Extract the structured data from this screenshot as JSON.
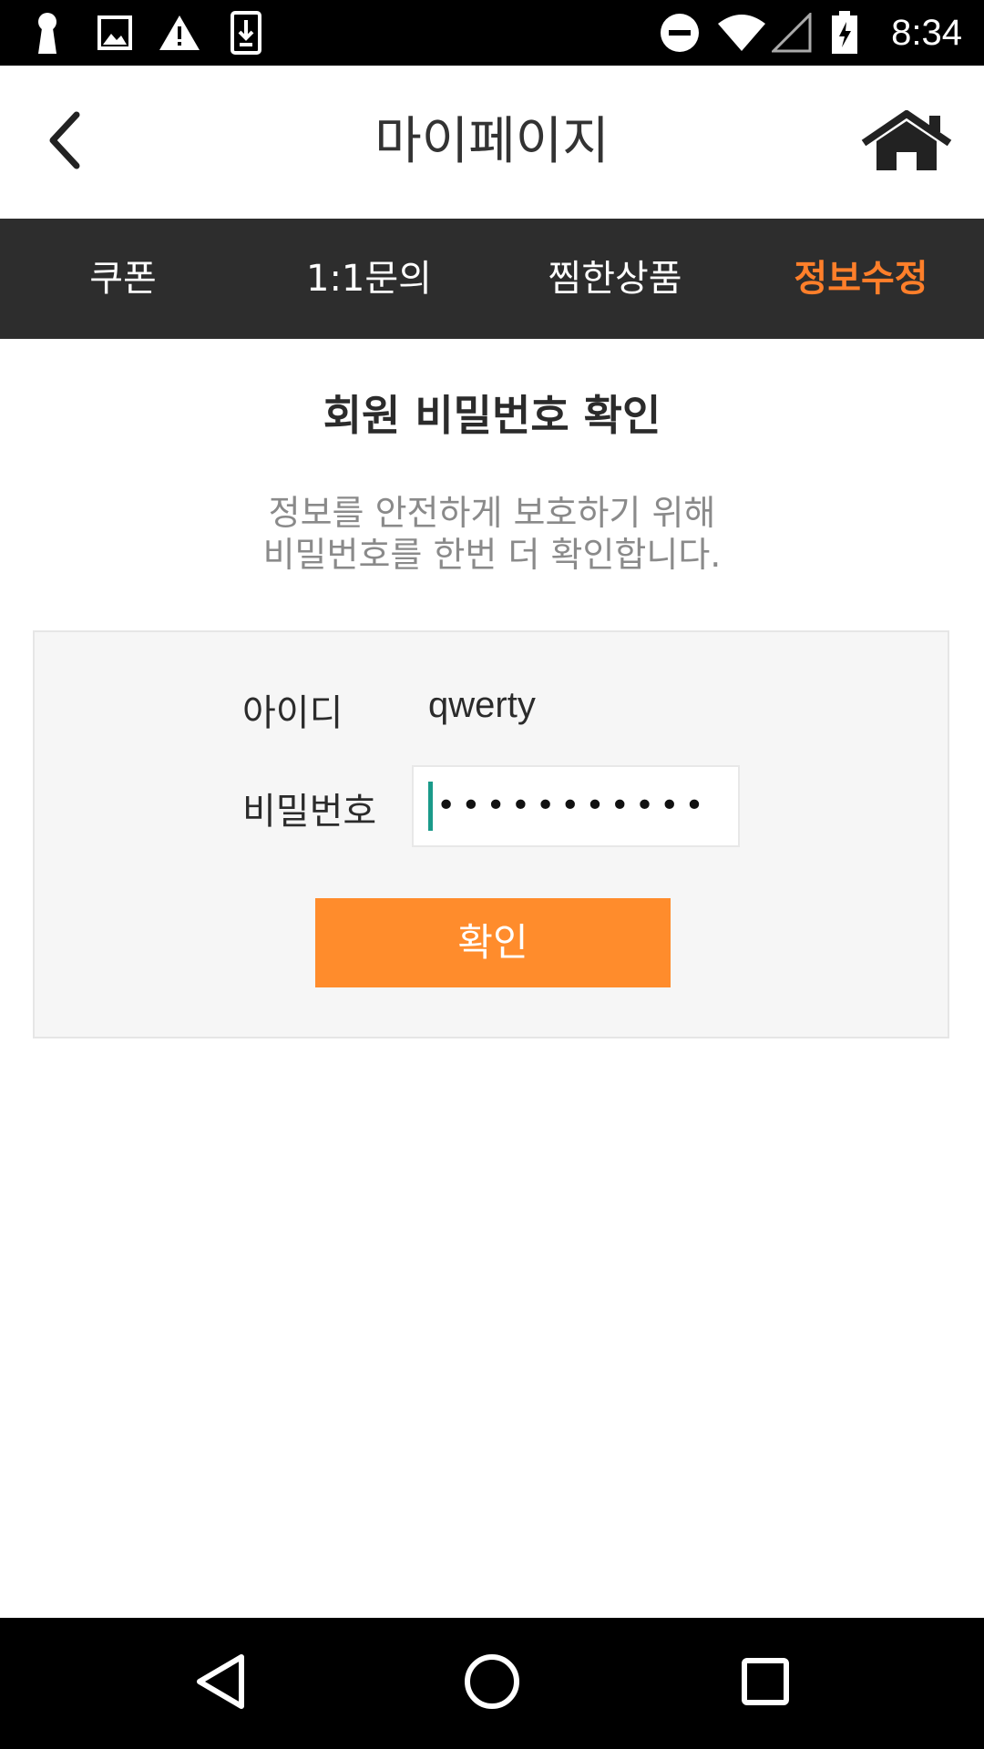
{
  "status_bar": {
    "time": "8:34",
    "left_icons": [
      "keyhole-icon",
      "image-icon",
      "warning-icon",
      "download-icon"
    ],
    "right_icons": [
      "do-not-disturb-icon",
      "wifi-icon",
      "signal-icon",
      "battery-charging-icon"
    ]
  },
  "header": {
    "title": "마이페이지",
    "back_icon": "back-arrow-icon",
    "home_icon": "home-icon"
  },
  "tabs": [
    {
      "label": "쿠폰",
      "active": false
    },
    {
      "label": "1:1문의",
      "active": false
    },
    {
      "label": "찜한상품",
      "active": false
    },
    {
      "label": "정보수정",
      "active": true
    }
  ],
  "content": {
    "title": "회원 비밀번호 확인",
    "desc_line1": "정보를 안전하게 보호하기 위해",
    "desc_line2": "비밀번호를 한번 더 확인합니다.",
    "id_label": "아이디",
    "id_value": "qwerty",
    "pw_label": "비밀번호",
    "pw_masked": "•••••••••••",
    "confirm_label": "확인"
  },
  "colors": {
    "accent": "#ff7f2a",
    "button": "#ff8c2c",
    "tab_bg": "#2d2d2d",
    "caret": "#1a9a8a"
  },
  "nav_bar": {
    "icons": [
      "nav-back-icon",
      "nav-home-icon",
      "nav-recents-icon"
    ]
  }
}
